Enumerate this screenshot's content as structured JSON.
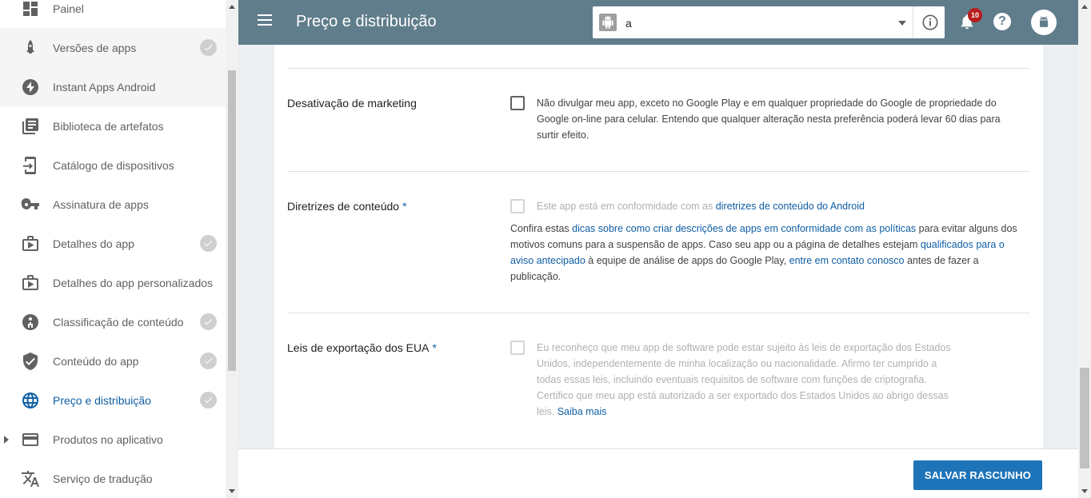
{
  "sidebar": {
    "items": [
      {
        "label": "Painel",
        "icon": "dashboard-icon",
        "checked": false
      },
      {
        "label": "Versões de apps",
        "icon": "rocket-icon",
        "checked": true
      },
      {
        "label": "Instant Apps Android",
        "icon": "bolt-icon",
        "checked": false
      },
      {
        "label": "Biblioteca de artefatos",
        "icon": "library-icon",
        "checked": false
      },
      {
        "label": "Catálogo de dispositivos",
        "icon": "device-catalog-icon",
        "checked": false
      },
      {
        "label": "Assinatura de apps",
        "icon": "key-icon",
        "checked": false
      },
      {
        "label": "Detalhes do app",
        "icon": "store-listing-icon",
        "checked": true
      },
      {
        "label": "Detalhes do app personalizados",
        "icon": "custom-listing-icon",
        "checked": false
      },
      {
        "label": "Classificação de conteúdo",
        "icon": "rating-icon",
        "checked": true
      },
      {
        "label": "Conteúdo do app",
        "icon": "shield-icon",
        "checked": true
      },
      {
        "label": "Preço e distribuição",
        "icon": "globe-icon",
        "checked": true,
        "active": true
      },
      {
        "label": "Produtos no aplicativo",
        "icon": "card-icon",
        "checked": false,
        "expandable": true
      },
      {
        "label": "Serviço de tradução",
        "icon": "translate-icon",
        "checked": false
      }
    ]
  },
  "header": {
    "title": "Preço e distribuição",
    "app_selector_value": "a",
    "notification_count": "10",
    "help_label": "?"
  },
  "sections": {
    "marketing": {
      "label": "Desativação de marketing",
      "text": "Não divulgar meu app, exceto no Google Play e em qualquer propriedade do Google de propriedade do Google on-line para celular. Entendo que qualquer alteração nesta preferência poderá levar 60 dias para surtir efeito."
    },
    "content": {
      "label": "Diretrizes de conteúdo",
      "required_mark": "*",
      "checkbox_text": "Este app está em conformidade com as ",
      "checkbox_link": "diretrizes de conteúdo do Android",
      "para_1": "Confira estas ",
      "para_link_1": "dicas sobre como criar descrições de apps em conformidade com as políticas",
      "para_2": " para evitar alguns dos motivos comuns para a suspensão de apps. Caso seu app ou a página de detalhes estejam ",
      "para_link_2": "qualificados para o aviso antecipado",
      "para_3": " à equipe de análise de apps do Google Play, ",
      "para_link_3": "entre em contato conosco",
      "para_4": " antes de fazer a publicação."
    },
    "export": {
      "label": "Leis de exportação dos EUA",
      "required_mark": "*",
      "text": "Eu reconheço que meu app de software pode estar sujeito às leis de exportação dos Estados Unidos, independentemente de minha localização ou nacionalidade. Afirmo ter cumprido a todas essas leis, incluindo eventuais requisitos de software com funções de criptografia. Certifico que meu app está autorizado a ser exportado dos Estados Unidos ao abrigo dessas leis. ",
      "link": "Saiba mais"
    }
  },
  "footer": {
    "save_label": "SALVAR RASCUNHO"
  },
  "colors": {
    "topbar": "#607d8b",
    "accent": "#0f5ea4",
    "button": "#1e74b8",
    "badge": "#b71c1c"
  }
}
